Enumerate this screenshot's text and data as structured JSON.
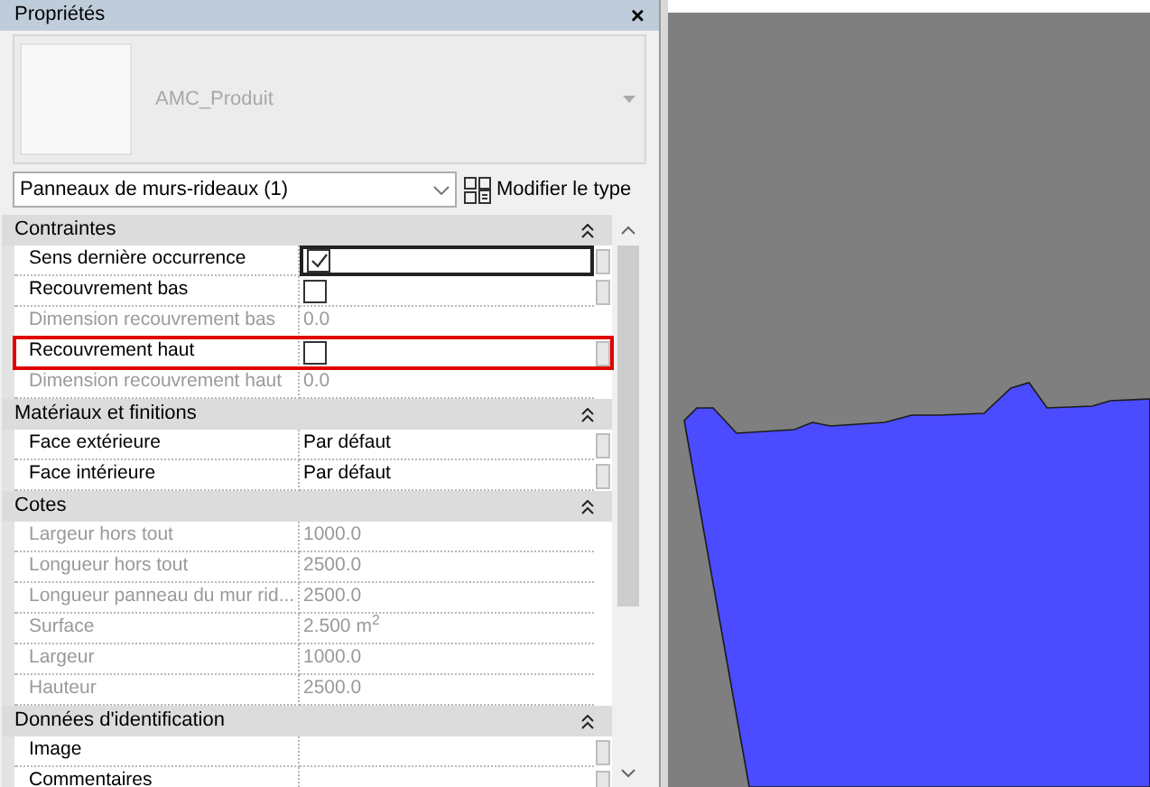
{
  "panel": {
    "title": "Propriétés",
    "close": "×"
  },
  "preview": {
    "type_name": "AMC_Produit"
  },
  "selector": {
    "value": "Panneaux de murs-rideaux (1)",
    "edit_type_button": "Modifier le type"
  },
  "groups": [
    {
      "title": "Contraintes",
      "expanded": true,
      "rows": [
        {
          "name": "Sens dernière occurrence",
          "kind": "checkbox",
          "checked": true,
          "disabled": false,
          "focused": true,
          "highlighted": false
        },
        {
          "name": "Recouvrement bas",
          "kind": "checkbox",
          "checked": false,
          "disabled": false,
          "focused": false,
          "highlighted": false
        },
        {
          "name": "Dimension recouvrement bas",
          "kind": "text",
          "value": "0.0",
          "disabled": true,
          "focused": false,
          "highlighted": false
        },
        {
          "name": "Recouvrement haut",
          "kind": "checkbox",
          "checked": false,
          "disabled": false,
          "focused": false,
          "highlighted": true
        },
        {
          "name": "Dimension recouvrement haut",
          "kind": "text",
          "value": "0.0",
          "disabled": true,
          "focused": false,
          "highlighted": false
        }
      ]
    },
    {
      "title": "Matériaux et finitions",
      "expanded": true,
      "rows": [
        {
          "name": "Face extérieure",
          "kind": "text",
          "value": "Par défaut",
          "disabled": false,
          "focused": false,
          "highlighted": false
        },
        {
          "name": "Face intérieure",
          "kind": "text",
          "value": "Par défaut",
          "disabled": false,
          "focused": false,
          "highlighted": false
        }
      ]
    },
    {
      "title": "Cotes",
      "expanded": true,
      "rows": [
        {
          "name": "Largeur hors tout",
          "kind": "text",
          "value": "1000.0",
          "disabled": true,
          "focused": false,
          "highlighted": false
        },
        {
          "name": "Longueur hors tout",
          "kind": "text",
          "value": "2500.0",
          "disabled": true,
          "focused": false,
          "highlighted": false
        },
        {
          "name": "Longueur panneau du mur rid...",
          "kind": "text",
          "value": "2500.0",
          "disabled": true,
          "focused": false,
          "highlighted": false
        },
        {
          "name": "Surface",
          "kind": "text",
          "value": "2.500 m$^{2}$",
          "disabled": true,
          "focused": false,
          "highlighted": false
        },
        {
          "name": "Largeur",
          "kind": "text",
          "value": "1000.0",
          "disabled": true,
          "focused": false,
          "highlighted": false
        },
        {
          "name": "Hauteur",
          "kind": "text",
          "value": "2500.0",
          "disabled": true,
          "focused": false,
          "highlighted": false
        }
      ]
    },
    {
      "title": "Données d'identification",
      "expanded": true,
      "rows": [
        {
          "name": "Image",
          "kind": "text",
          "disabled": false,
          "focused": false,
          "highlighted": false
        },
        {
          "name": "Commentaires",
          "kind": "text",
          "disabled": false,
          "focused": false,
          "highlighted": false
        }
      ]
    }
  ]
}
